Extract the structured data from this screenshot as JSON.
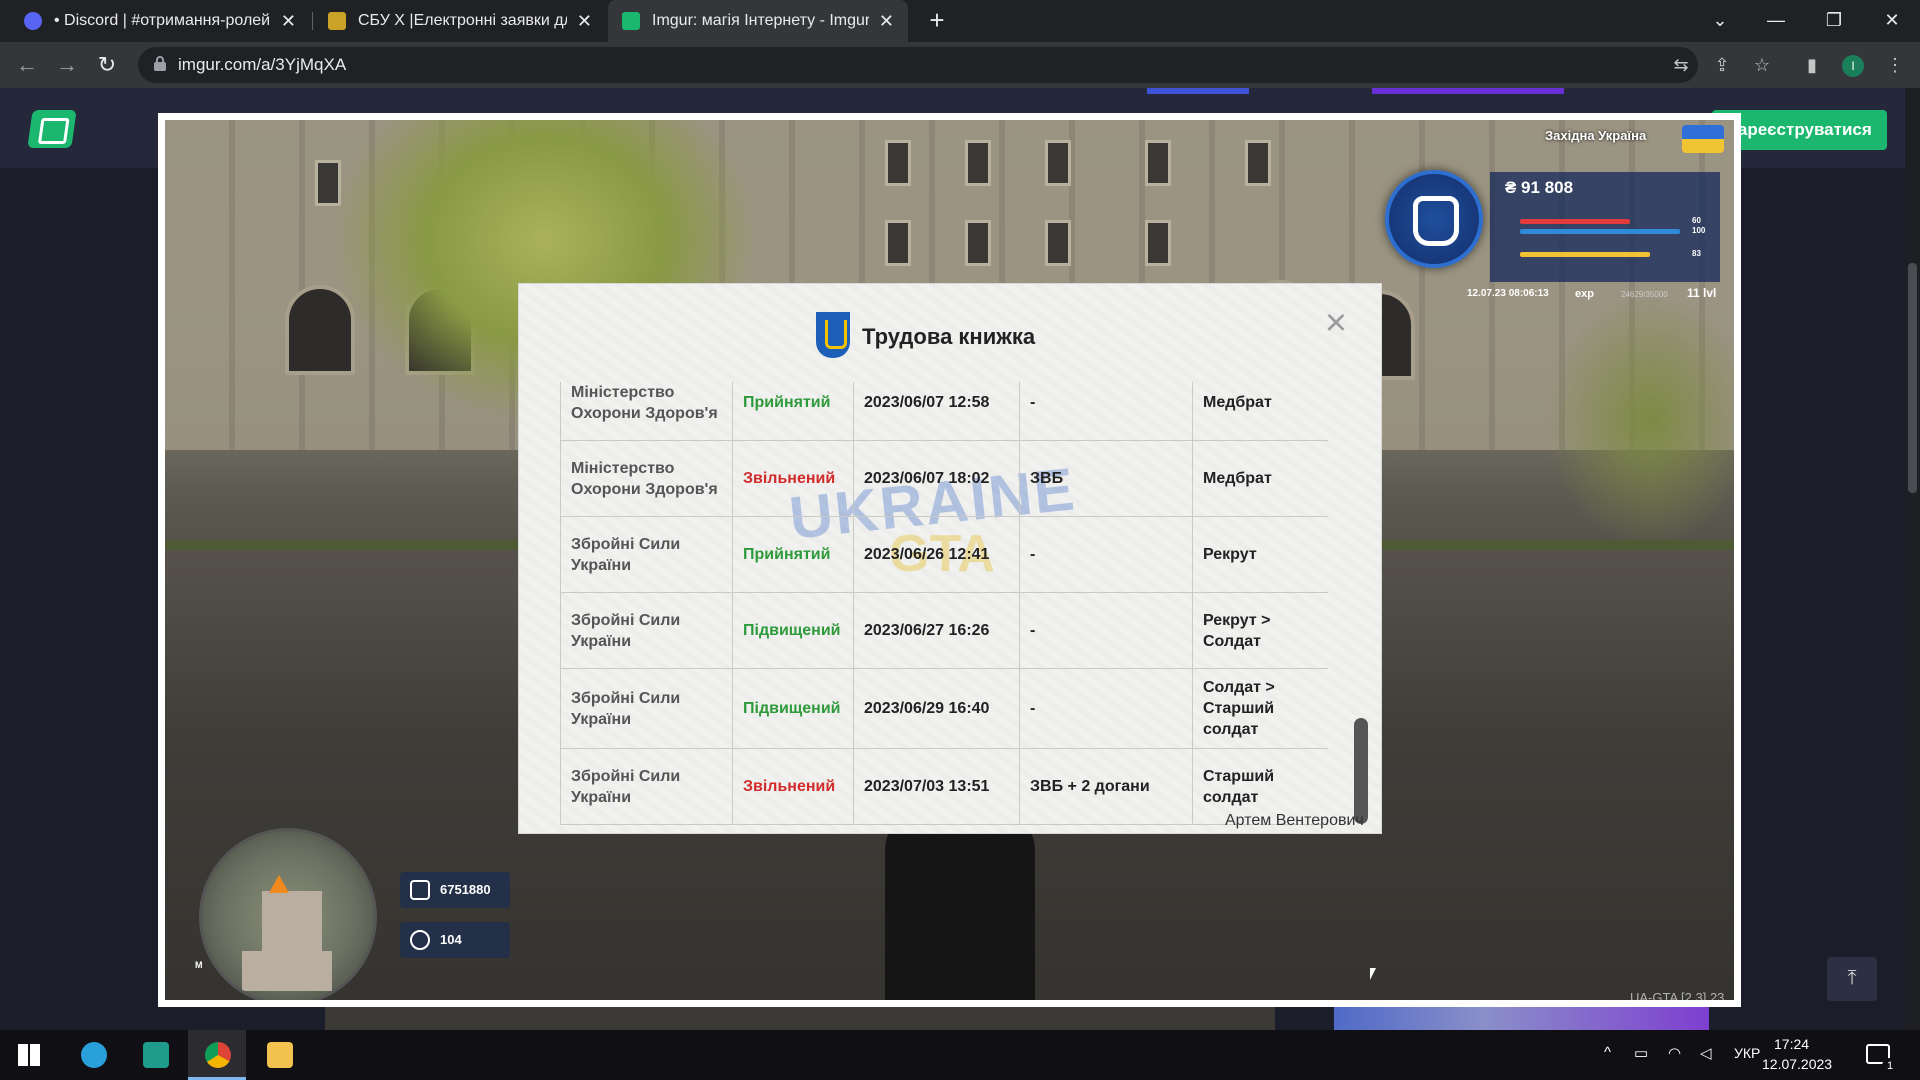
{
  "browser": {
    "tabs": [
      {
        "title": "• Discord | #отримання-ролей |",
        "favicon": "discord-icon",
        "active": false
      },
      {
        "title": "СБУ X |Електронні заявки для вс",
        "favicon": "sbu-icon",
        "active": false
      },
      {
        "title": "Imgur: магія Інтернету - Imgur",
        "favicon": "imgur-icon",
        "active": true
      }
    ],
    "url": "imgur.com/a/3YjMqXA",
    "profile_initial": "I",
    "new_tab_symbol": "+"
  },
  "imgur": {
    "register_label": "Зареєструватися"
  },
  "game": {
    "hud": {
      "region": "Західна Україна",
      "money": "₴ 91 808",
      "bar1_value": "60",
      "bar2_value": "100",
      "bar3_value": "83",
      "timestamp": "12.07.23 08:06:13",
      "exp_label": "exp",
      "exp_value": "24629/35000",
      "level": "11 lvl",
      "chip1_value": "6751880",
      "chip2_value": "104",
      "map_marker": "M",
      "watermark": "UA-GTA [2.3] 23"
    },
    "dialog": {
      "title": "Трудова книжка",
      "close_symbol": "×",
      "rows": [
        {
          "org": "Міністерство Охорони Здоров'я",
          "status": "Прийнятий",
          "status_type": "accepted",
          "datetime": "2023/06/07 12:58",
          "reason": "-",
          "position": "Медбрат"
        },
        {
          "org": "Міністерство Охорони Здоров'я",
          "status": "Звільнений",
          "status_type": "fired",
          "datetime": "2023/06/07 18:02",
          "reason": "ЗВБ",
          "position": "Медбрат"
        },
        {
          "org": "Збройні Сили України",
          "status": "Прийнятий",
          "status_type": "accepted",
          "datetime": "2023/06/26 12:41",
          "reason": "-",
          "position": "Рекрут"
        },
        {
          "org": "Збройні Сили України",
          "status": "Підвищений",
          "status_type": "promoted",
          "datetime": "2023/06/27 16:26",
          "reason": "-",
          "position": "Рекрут > Солдат"
        },
        {
          "org": "Збройні Сили України",
          "status": "Підвищений",
          "status_type": "promoted",
          "datetime": "2023/06/29 16:40",
          "reason": "-",
          "position": "Солдат > Старший солдат"
        },
        {
          "org": "Збройні Сили України",
          "status": "Звільнений",
          "status_type": "fired",
          "datetime": "2023/07/03 13:51",
          "reason": "ЗВБ + 2 догани",
          "position": "Старший солдат"
        }
      ],
      "watermark_top": "UKRAINE",
      "watermark_bottom": "GTA",
      "signature": "Артем Вентерович"
    }
  },
  "taskbar": {
    "apps": [
      "start-icon",
      "telegram-icon",
      "code-editor-icon",
      "chrome-icon",
      "file-explorer-icon"
    ],
    "language": "УКР",
    "time": "17:24",
    "date": "12.07.2023",
    "notification_count": "1"
  },
  "colors": {
    "accent_green": "#1bb76e",
    "status_accepted": "#2e9a3b",
    "status_fired": "#d22b2b",
    "hud_blue": "#1f4f9c"
  }
}
